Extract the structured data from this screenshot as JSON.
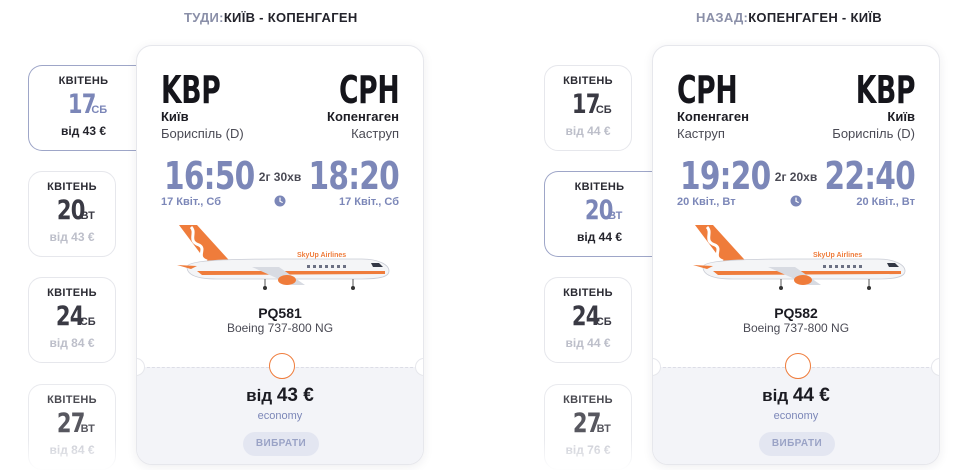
{
  "outbound": {
    "title_prefix": "ТУДИ:",
    "title_route": "КИЇВ - КОПЕНГАГЕН",
    "dates": [
      {
        "month": "КВІТЕНЬ",
        "day": "17",
        "weekday": "СБ",
        "price": "від 43 €",
        "selected": true
      },
      {
        "month": "КВІТЕНЬ",
        "day": "20",
        "weekday": "ВТ",
        "price": "від 43 €",
        "selected": false
      },
      {
        "month": "КВІТЕНЬ",
        "day": "24",
        "weekday": "СБ",
        "price": "від 84 €",
        "selected": false
      },
      {
        "month": "КВІТЕНЬ",
        "day": "27",
        "weekday": "ВТ",
        "price": "від 84 €",
        "selected": false
      }
    ],
    "flight": {
      "from_code": "KBP",
      "from_city": "Київ",
      "from_airport": "Бориспіль (D)",
      "to_code": "CPH",
      "to_city": "Копенгаген",
      "to_airport": "Каструп",
      "dep_time": "16:50",
      "dep_date": "17 Квіт., Сб",
      "arr_time": "18:20",
      "arr_date": "17 Квіт., Сб",
      "duration": "2г 30хв",
      "number": "PQ581",
      "aircraft": "Boeing 737-800 NG",
      "price_prefix": "від",
      "price": "43 €",
      "fare_class": "economy",
      "select_label": "ВИБРАТИ"
    }
  },
  "return": {
    "title_prefix": "НАЗАД:",
    "title_route": "КОПЕНГАГЕН - КИЇВ",
    "dates": [
      {
        "month": "КВІТЕНЬ",
        "day": "17",
        "weekday": "СБ",
        "price": "від 44 €",
        "selected": false
      },
      {
        "month": "КВІТЕНЬ",
        "day": "20",
        "weekday": "ВТ",
        "price": "від 44 €",
        "selected": true
      },
      {
        "month": "КВІТЕНЬ",
        "day": "24",
        "weekday": "СБ",
        "price": "від 44 €",
        "selected": false
      },
      {
        "month": "КВІТЕНЬ",
        "day": "27",
        "weekday": "ВТ",
        "price": "від 76 €",
        "selected": false
      }
    ],
    "flight": {
      "from_code": "CPH",
      "from_city": "Копенгаген",
      "from_airport": "Каструп",
      "to_code": "KBP",
      "to_city": "Київ",
      "to_airport": "Бориспіль (D)",
      "dep_time": "19:20",
      "dep_date": "20 Квіт., Вт",
      "arr_time": "22:40",
      "arr_date": "20 Квіт., Вт",
      "duration": "2г 20хв",
      "number": "PQ582",
      "aircraft": "Boeing 737-800 NG",
      "price_prefix": "від",
      "price": "44 €",
      "fare_class": "economy",
      "select_label": "ВИБРАТИ"
    }
  },
  "airline_logo": "SkyUp Airlines",
  "colors": {
    "accent_orange": "#ef7c3b",
    "time_blue": "#7c87b8",
    "selected_border": "#9ea6c8"
  }
}
